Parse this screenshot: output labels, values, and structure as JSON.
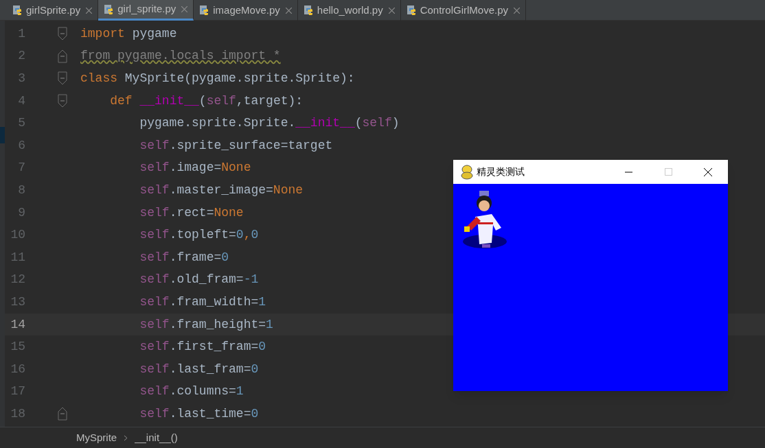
{
  "tabs": [
    {
      "label": "girlSprite.py",
      "selected": false
    },
    {
      "label": "girl_sprite.py",
      "selected": true
    },
    {
      "label": "imageMove.py",
      "selected": false
    },
    {
      "label": "hello_world.py",
      "selected": false
    },
    {
      "label": "ControlGirlMove.py",
      "selected": false
    }
  ],
  "editor": {
    "lines": [
      {
        "number": "1",
        "current": false,
        "fold_open": true,
        "fold_close": false,
        "tokens": [
          {
            "t": "import ",
            "kind": "keyword"
          },
          {
            "t": "pygame",
            "kind": "plain"
          }
        ]
      },
      {
        "number": "2",
        "current": false,
        "fold_open": false,
        "fold_close": true,
        "tokens": [
          {
            "t": "from pygame.locals import *",
            "kind": "unused"
          }
        ]
      },
      {
        "number": "3",
        "current": false,
        "fold_open": true,
        "fold_close": false,
        "tokens": [
          {
            "t": "class ",
            "kind": "keyword"
          },
          {
            "t": "MySprite(pygame.sprite.Sprite):",
            "kind": "plain"
          }
        ]
      },
      {
        "number": "4",
        "current": false,
        "fold_open": true,
        "fold_close": false,
        "tokens": [
          {
            "t": "    def ",
            "kind": "keyword"
          },
          {
            "t": "__init__",
            "kind": "magic"
          },
          {
            "t": "(",
            "kind": "plain"
          },
          {
            "t": "self",
            "kind": "self"
          },
          {
            "t": ",target):",
            "kind": "plain"
          }
        ]
      },
      {
        "number": "5",
        "current": false,
        "fold_open": false,
        "fold_close": false,
        "tokens": [
          {
            "t": "        pygame.sprite.Sprite.",
            "kind": "plain"
          },
          {
            "t": "__init__",
            "kind": "magic"
          },
          {
            "t": "(",
            "kind": "plain"
          },
          {
            "t": "self",
            "kind": "self"
          },
          {
            "t": ")",
            "kind": "plain"
          }
        ]
      },
      {
        "number": "6",
        "current": false,
        "fold_open": false,
        "fold_close": false,
        "tokens": [
          {
            "t": "        self",
            "kind": "self"
          },
          {
            "t": ".sprite_surface=target",
            "kind": "plain"
          }
        ]
      },
      {
        "number": "7",
        "current": false,
        "fold_open": false,
        "fold_close": false,
        "tokens": [
          {
            "t": "        self",
            "kind": "self"
          },
          {
            "t": ".image=",
            "kind": "plain"
          },
          {
            "t": "None",
            "kind": "keyword"
          }
        ]
      },
      {
        "number": "8",
        "current": false,
        "fold_open": false,
        "fold_close": false,
        "tokens": [
          {
            "t": "        self",
            "kind": "self"
          },
          {
            "t": ".master_image=",
            "kind": "plain"
          },
          {
            "t": "None",
            "kind": "keyword"
          }
        ]
      },
      {
        "number": "9",
        "current": false,
        "fold_open": false,
        "fold_close": false,
        "tokens": [
          {
            "t": "        self",
            "kind": "self"
          },
          {
            "t": ".rect=",
            "kind": "plain"
          },
          {
            "t": "None",
            "kind": "keyword"
          }
        ]
      },
      {
        "number": "10",
        "current": false,
        "fold_open": false,
        "fold_close": false,
        "tokens": [
          {
            "t": "        self",
            "kind": "self"
          },
          {
            "t": ".topleft=",
            "kind": "plain"
          },
          {
            "t": "0",
            "kind": "number"
          },
          {
            "t": ",",
            "kind": "keyword"
          },
          {
            "t": "0",
            "kind": "number"
          }
        ]
      },
      {
        "number": "11",
        "current": false,
        "fold_open": false,
        "fold_close": false,
        "tokens": [
          {
            "t": "        self",
            "kind": "self"
          },
          {
            "t": ".frame=",
            "kind": "plain"
          },
          {
            "t": "0",
            "kind": "number"
          }
        ]
      },
      {
        "number": "12",
        "current": false,
        "fold_open": false,
        "fold_close": false,
        "tokens": [
          {
            "t": "        self",
            "kind": "self"
          },
          {
            "t": ".old_fram=",
            "kind": "plain"
          },
          {
            "t": "-1",
            "kind": "number"
          }
        ]
      },
      {
        "number": "13",
        "current": false,
        "fold_open": false,
        "fold_close": false,
        "tokens": [
          {
            "t": "        self",
            "kind": "self"
          },
          {
            "t": ".fram_width=",
            "kind": "plain"
          },
          {
            "t": "1",
            "kind": "number"
          }
        ]
      },
      {
        "number": "14",
        "current": true,
        "fold_open": false,
        "fold_close": false,
        "tokens": [
          {
            "t": "        self",
            "kind": "self"
          },
          {
            "t": ".fram_height=",
            "kind": "plain"
          },
          {
            "t": "1",
            "kind": "number"
          }
        ]
      },
      {
        "number": "15",
        "current": false,
        "fold_open": false,
        "fold_close": false,
        "tokens": [
          {
            "t": "        self",
            "kind": "self"
          },
          {
            "t": ".first_fram=",
            "kind": "plain"
          },
          {
            "t": "0",
            "kind": "number"
          }
        ]
      },
      {
        "number": "16",
        "current": false,
        "fold_open": false,
        "fold_close": false,
        "tokens": [
          {
            "t": "        self",
            "kind": "self"
          },
          {
            "t": ".last_fram=",
            "kind": "plain"
          },
          {
            "t": "0",
            "kind": "number"
          }
        ]
      },
      {
        "number": "17",
        "current": false,
        "fold_open": false,
        "fold_close": false,
        "tokens": [
          {
            "t": "        self",
            "kind": "self"
          },
          {
            "t": ".columns=",
            "kind": "plain"
          },
          {
            "t": "1",
            "kind": "number"
          }
        ]
      },
      {
        "number": "18",
        "current": false,
        "fold_open": false,
        "fold_close": true,
        "tokens": [
          {
            "t": "        self",
            "kind": "self"
          },
          {
            "t": ".last_time=",
            "kind": "plain"
          },
          {
            "t": "0",
            "kind": "number"
          }
        ]
      }
    ]
  },
  "breadcrumb": [
    "MySprite",
    "__init__()"
  ],
  "game_window": {
    "title": "精灵类测试"
  }
}
